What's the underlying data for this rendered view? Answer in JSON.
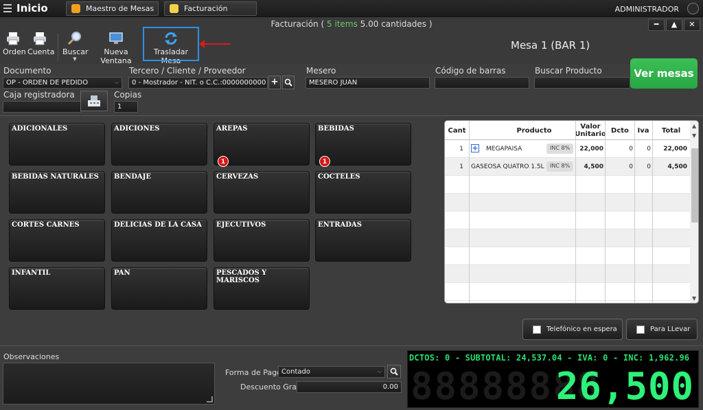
{
  "topbar": {
    "app_title": "Inicio",
    "tabs": [
      {
        "label": "Maestro de Mesas",
        "icon": "shield-icon",
        "color": "#f0a020"
      },
      {
        "label": "Facturación",
        "icon": "document-icon",
        "color": "#f2d04a"
      }
    ],
    "user": "ADMINISTRADOR"
  },
  "status": {
    "prefix": "Facturación (",
    "items": "5 items",
    "cantidades": "5.00 cantidades )"
  },
  "toolbar": {
    "orden": "Orden",
    "cuenta": "Cuenta",
    "buscar": "Buscar",
    "nueva_ventana": "Nueva Ventana",
    "trasladar_mesa": "Trasladar Mesa"
  },
  "mesa_title": "Mesa 1 (BAR 1)",
  "form": {
    "documento_label": "Documento",
    "documento_value": "OP - ORDEN DE PEDIDO",
    "tercero_label": "Tercero / Cliente / Proveedor",
    "tercero_value": "0 - Mostrador - NIT. o C.C.:0000000000",
    "mesero_label": "Mesero",
    "mesero_value": "MESERO JUAN",
    "codigo_label": "Código de barras",
    "codigo_value": "",
    "buscar_producto_label": "Buscar Producto",
    "buscar_producto_value": "",
    "caja_label": "Caja registradora",
    "caja_value": "",
    "copias_label": "Copias",
    "copias_value": "1",
    "ver_mesas": "Ver mesas"
  },
  "categories": [
    {
      "label": "ADICIONALES",
      "badge": ""
    },
    {
      "label": "ADICIONES",
      "badge": ""
    },
    {
      "label": "AREPAS",
      "badge": "1"
    },
    {
      "label": "BEBIDAS",
      "badge": "1"
    },
    {
      "label": "BEBIDAS NATURALES",
      "badge": ""
    },
    {
      "label": "BENDAJE",
      "badge": ""
    },
    {
      "label": "CERVEZAS",
      "badge": ""
    },
    {
      "label": "COCTELES",
      "badge": ""
    },
    {
      "label": "CORTES CARNES",
      "badge": ""
    },
    {
      "label": "DELICIAS DE LA CASA",
      "badge": ""
    },
    {
      "label": "EJECUTIVOS",
      "badge": ""
    },
    {
      "label": "ENTRADAS",
      "badge": ""
    },
    {
      "label": "INFANTIL",
      "badge": ""
    },
    {
      "label": "PAN",
      "badge": ""
    },
    {
      "label": "PESCADOS Y MARISCOS",
      "badge": ""
    }
  ],
  "order_table": {
    "headers": {
      "cant": "Cant",
      "producto": "Producto",
      "valor1": "Valor",
      "valor2": "Unitario",
      "dcto": "Dcto",
      "iva": "Iva",
      "total": "Total"
    },
    "rows": [
      {
        "cant": "1",
        "producto": "MEGAPAISA",
        "inc": "INC 8%",
        "valor": "22,000",
        "dcto": "0",
        "iva": "0",
        "total": "22,000"
      },
      {
        "cant": "1",
        "producto": "GASEOSA QUATRO 1.5L",
        "inc": "INC 8%",
        "valor": "4,500",
        "dcto": "0",
        "iva": "0",
        "total": "4,500"
      }
    ]
  },
  "buttons": {
    "telefonico": "Telefónico en espera",
    "para_llevar": "Para LLevar"
  },
  "bottom": {
    "observaciones_label": "Observaciones",
    "forma_pago_label": "Forma de Pago",
    "forma_pago_value": "Contado",
    "descuento_label": "Descuento Gral.",
    "descuento_value": "0.00"
  },
  "display": {
    "info": "DCTOS: 0 - SUBTOTAL: 24,537.04 - IVA: 0 - INC: 1,962.96",
    "ghost": "88888888",
    "total": "26,500"
  }
}
